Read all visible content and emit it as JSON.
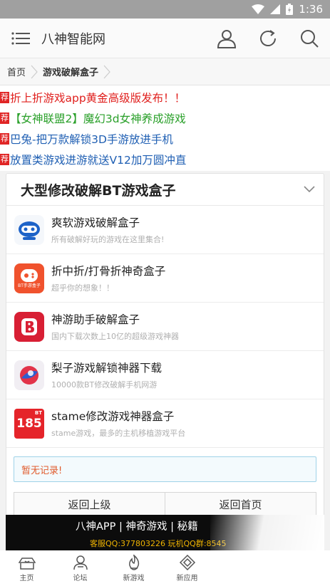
{
  "status": {
    "time": "1:36"
  },
  "header": {
    "title": "八神智能网"
  },
  "breadcrumb": {
    "home": "首页",
    "current": "游戏破解盒子"
  },
  "ads": [
    {
      "tag": "荐",
      "text": "折上折游戏app黄金高级版发布！！",
      "color": "#e0201e"
    },
    {
      "tag": "荐",
      "text": "【女神联盟2】魔幻3d女神养成游戏",
      "color": "#2aa02a"
    },
    {
      "tag": "荐",
      "text": "巴兔-把万款解锁3D手游放进手机",
      "color": "#1f5fb3"
    },
    {
      "tag": "荐",
      "text": "放置类游戏进游就送V12加万圆冲直",
      "color": "#1f5fb3"
    }
  ],
  "section": {
    "title": "大型修改破解BT游戏盒子",
    "items": [
      {
        "name": "爽软游戏破解盒子",
        "desc": "所有破解好玩的游戏在这里集合!"
      },
      {
        "name": "折中折/打骨折神奇盒子",
        "desc": "超乎你的想象！！",
        "logo_text": "BT手游盒子"
      },
      {
        "name": "神游助手破解盒子",
        "desc": "国内下载次数上10亿的超级游戏神器"
      },
      {
        "name": "梨子游戏解锁神器下载",
        "desc": "10000款BT修改破解手机网游"
      },
      {
        "name": "stame修改游戏神器盒子",
        "desc": "stame游戏，最多的主机移植游戏平台",
        "logo_text": "185",
        "logo_badge": "BT"
      }
    ],
    "no_record": "暂无记录!",
    "back_label": "返回上级",
    "home_label": "返回首页"
  },
  "banner": {
    "line1": "八神APP  |  神奇游戏  |  秘籍",
    "line2": "客服QQ:377803226 玩机QQ群:8545"
  },
  "tabs": [
    {
      "label": "主页"
    },
    {
      "label": "论坛"
    },
    {
      "label": "新游戏"
    },
    {
      "label": "新应用"
    }
  ]
}
